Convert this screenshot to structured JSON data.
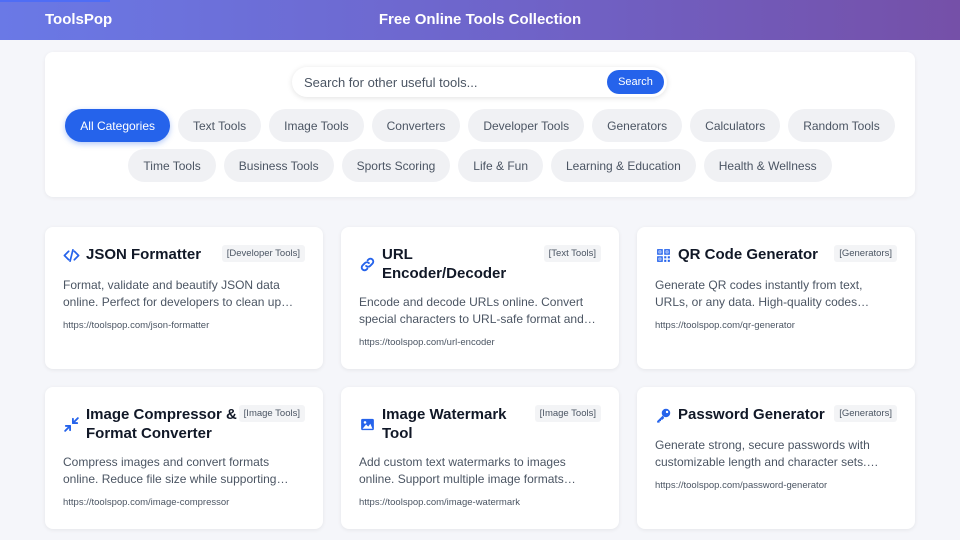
{
  "header": {
    "brand": "ToolsPop",
    "title": "Free Online Tools Collection"
  },
  "search": {
    "placeholder": "Search for other useful tools...",
    "button_label": "Search"
  },
  "categories": {
    "row1": [
      "All Categories",
      "Text Tools",
      "Image Tools",
      "Converters",
      "Developer Tools",
      "Generators",
      "Calculators",
      "Random Tools"
    ],
    "row2": [
      "Time Tools",
      "Business Tools",
      "Sports Scoring",
      "Life & Fun",
      "Learning & Education",
      "Health & Wellness"
    ],
    "active": "All Categories"
  },
  "cards": [
    {
      "icon": "code-icon",
      "title": "JSON Formatter",
      "tag": "[Developer Tools]",
      "description": "Format, validate and beautify JSON data online. Perfect for developers to clean up messy JSON.",
      "url": "https://toolspop.com/json-formatter"
    },
    {
      "icon": "link-icon",
      "title": "URL Encoder/Decoder",
      "tag": "[Text Tools]",
      "description": "Encode and decode URLs online. Convert special characters to URL-safe format and vice versa.",
      "url": "https://toolspop.com/url-encoder"
    },
    {
      "icon": "qrcode-icon",
      "title": "QR Code Generator",
      "tag": "[Generators]",
      "description": "Generate QR codes instantly from text, URLs, or any data. High-quality codes perfect for sharing.",
      "url": "https://toolspop.com/qr-generator"
    },
    {
      "icon": "compress-icon",
      "title": "Image Compressor & Format Converter",
      "tag": "[Image Tools]",
      "description": "Compress images and convert formats online. Reduce file size while supporting conversion between formats.",
      "url": "https://toolspop.com/image-compressor"
    },
    {
      "icon": "image-icon",
      "title": "Image Watermark Tool",
      "tag": "[Image Tools]",
      "description": "Add custom text watermarks to images online. Support multiple image formats including PNG and JPG.",
      "url": "https://toolspop.com/image-watermark"
    },
    {
      "icon": "key-icon",
      "title": "Password Generator",
      "tag": "[Generators]",
      "description": "Generate strong, secure passwords with customizable length and character sets. Keep your accounts safe.",
      "url": "https://toolspop.com/password-generator"
    }
  ],
  "colors": {
    "accent": "#2563eb",
    "header_start": "#6a79e6",
    "header_end": "#7550a8"
  }
}
